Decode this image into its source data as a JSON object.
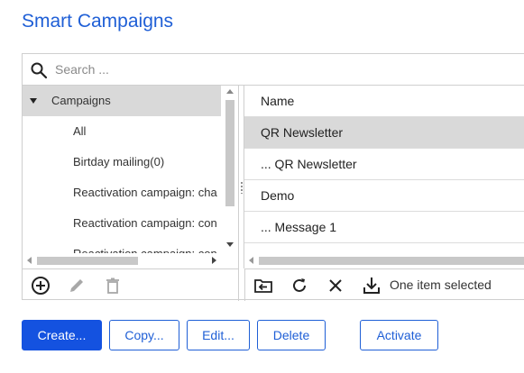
{
  "page": {
    "title": "Smart Campaigns"
  },
  "search": {
    "placeholder": "Search ..."
  },
  "tree": {
    "root_label": "Campaigns",
    "items": [
      {
        "label": "All"
      },
      {
        "label": "Birtday mailing(0)"
      },
      {
        "label": "Reactivation campaign: cha"
      },
      {
        "label": "Reactivation campaign: con"
      },
      {
        "label": "Reactivation campaign: con"
      }
    ]
  },
  "list": {
    "column_header": "Name",
    "rows": [
      {
        "name": "QR Newsletter",
        "selected": true
      },
      {
        "name": "... QR Newsletter",
        "selected": false
      },
      {
        "name": "Demo",
        "selected": false
      },
      {
        "name": "... Message 1",
        "selected": false
      }
    ]
  },
  "tree_toolbar": {
    "icons": [
      "add-circle-icon",
      "pencil-icon",
      "trash-icon"
    ]
  },
  "list_toolbar": {
    "icons": [
      "move-folder-icon",
      "refresh-icon",
      "close-icon",
      "download-icon"
    ],
    "status": "One item selected"
  },
  "actions": {
    "create": "Create...",
    "copy": "Copy...",
    "edit": "Edit...",
    "delete": "Delete",
    "activate": "Activate"
  },
  "colors": {
    "accent": "#1f5fd6",
    "primary_button": "#1452e0",
    "selected_row": "#d9d9d9",
    "disabled_icon": "#a8a8a8"
  }
}
